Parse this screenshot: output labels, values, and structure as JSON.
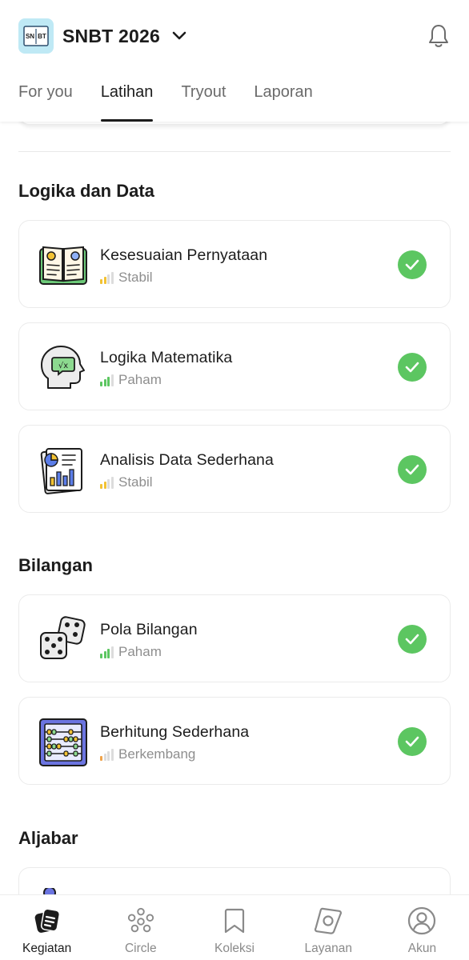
{
  "header": {
    "app_title": "SNBT 2026",
    "logo_text": "SN BT",
    "tabs": [
      {
        "label": "For you",
        "active": false
      },
      {
        "label": "Latihan",
        "active": true
      },
      {
        "label": "Tryout",
        "active": false
      },
      {
        "label": "Laporan",
        "active": false
      }
    ]
  },
  "sections": [
    {
      "title": "Logika dan Data",
      "items": [
        {
          "title": "Kesesuaian Pernyataan",
          "level": "Stabil",
          "level_color": "#f2c233",
          "level_bars": 2,
          "icon": "open-book-icon",
          "completed": true
        },
        {
          "title": "Logika Matematika",
          "level": "Paham",
          "level_color": "#5cc661",
          "level_bars": 3,
          "icon": "head-math-icon",
          "completed": true
        },
        {
          "title": "Analisis Data Sederhana",
          "level": "Stabil",
          "level_color": "#f2c233",
          "level_bars": 2,
          "icon": "data-report-icon",
          "completed": true
        }
      ]
    },
    {
      "title": "Bilangan",
      "items": [
        {
          "title": "Pola Bilangan",
          "level": "Paham",
          "level_color": "#5cc661",
          "level_bars": 3,
          "icon": "dice-icon",
          "completed": true
        },
        {
          "title": "Berhitung Sederhana",
          "level": "Berkembang",
          "level_color": "#f0a34a",
          "level_bars": 1,
          "icon": "abacus-icon",
          "completed": true
        }
      ]
    },
    {
      "title": "Aljabar",
      "items": []
    }
  ],
  "bottom_nav": [
    {
      "label": "Kegiatan",
      "icon": "kegiatan-icon",
      "active": true
    },
    {
      "label": "Circle",
      "icon": "circle-people-icon",
      "active": false
    },
    {
      "label": "Koleksi",
      "icon": "bookmark-icon",
      "active": false
    },
    {
      "label": "Layanan",
      "icon": "layanan-icon",
      "active": false
    },
    {
      "label": "Akun",
      "icon": "account-icon",
      "active": false
    }
  ],
  "colors": {
    "check_green": "#5cc661",
    "text_primary": "#1c1c1c",
    "text_muted": "#8e8e8e"
  }
}
